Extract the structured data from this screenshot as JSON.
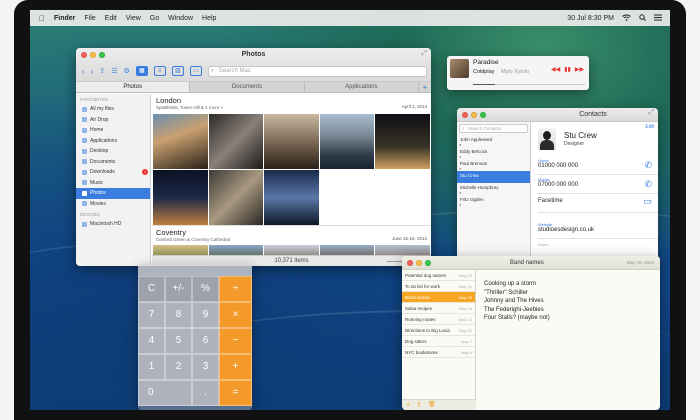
{
  "menubar": {
    "apple": "",
    "app_name": "Finder",
    "menus": [
      "File",
      "Edit",
      "View",
      "Go",
      "Window",
      "Help"
    ],
    "clock": "30 Jul  8:30 PM",
    "wifi_icon": "wifi-icon",
    "search_icon": "search-icon",
    "list_icon": "list-icon"
  },
  "finder": {
    "title": "Photos",
    "search_placeholder": "Search Mac",
    "tabs": [
      {
        "label": "Photos",
        "active": true
      },
      {
        "label": "Documents",
        "active": false
      },
      {
        "label": "Applications",
        "active": false
      }
    ],
    "tab_add": "+",
    "sidebar": {
      "favourites_header": "FAVOURITES",
      "items": [
        {
          "label": "All my files"
        },
        {
          "label": "Air Drop"
        },
        {
          "label": "Home"
        },
        {
          "label": "Applications"
        },
        {
          "label": "Desktop"
        },
        {
          "label": "Documents"
        },
        {
          "label": "Downloads",
          "badge": "!"
        },
        {
          "label": "Music"
        },
        {
          "label": "Photos",
          "selected": true
        },
        {
          "label": "Movies"
        }
      ],
      "devices_header": "DEVICES",
      "devices": [
        {
          "label": "Macintosh HD"
        }
      ]
    },
    "events": [
      {
        "title": "London",
        "subtitle": "Spitalfields, Tower Hill & 1 more >",
        "date": "April 2, 2013"
      },
      {
        "title": "Coventry",
        "subtitle": "Gosford Green & Coventry Cathedral",
        "date": "June 15-16, 2013"
      }
    ],
    "status": "10,371 items",
    "zoom_level": 0.65
  },
  "notification": {
    "track": "Paradise",
    "artist": "Coldplay",
    "album": "Mylo Xyloto",
    "controls": [
      "◀◀",
      "▮▮",
      "▶▶"
    ],
    "progress": 0.2
  },
  "contacts": {
    "title": "Contacts",
    "search_placeholder": "Search Contacts",
    "list": [
      {
        "name": "John Appleseed"
      },
      {
        "name": "Eddy Belcock"
      },
      {
        "name": "Paul Brennan"
      },
      {
        "name": "Stu Crew",
        "selected": true
      },
      {
        "name": "Michelle Humphrey"
      },
      {
        "name": "Fritz Ogden"
      }
    ],
    "edit_label": "Edit",
    "name": "Stu Crew",
    "role": "Designer",
    "fields": [
      {
        "label": "Home",
        "value": "01000 000 000"
      },
      {
        "label": "Mobile",
        "value": "07000 000 000"
      },
      {
        "label": "",
        "value": "Facetime"
      },
      {
        "label": "Website",
        "value": "studioesdesign.co.uk"
      }
    ],
    "note_label": "Notes",
    "bottom_buttons": [
      "+",
      "⇪",
      "🗑"
    ]
  },
  "calculator": {
    "keys": [
      "C",
      "+/-",
      "%",
      "÷",
      "7",
      "8",
      "9",
      "×",
      "4",
      "5",
      "6",
      "−",
      "1",
      "2",
      "3",
      "+",
      "0",
      ".",
      "="
    ]
  },
  "notes": {
    "title": "Band names",
    "date": "May 29, 2013",
    "list": [
      {
        "title": "Potential dog names",
        "date": "May 23"
      },
      {
        "title": "To do list for work",
        "date": "May 21"
      },
      {
        "title": "Band names",
        "date": "May 29",
        "selected": true
      },
      {
        "title": "Salsa recipes",
        "date": "May 14"
      },
      {
        "title": "Running routes",
        "date": "May 12"
      },
      {
        "title": "Directions to Big Lucia",
        "date": "May 10"
      },
      {
        "title": "Dog sitters",
        "date": "May 7"
      },
      {
        "title": "NYC bookstores",
        "date": "May 6"
      }
    ],
    "body": [
      "Cooking up a storm",
      "\"Thriller\" Schiller",
      "Johnny and The Hives",
      "The Federighi-Jeebies",
      "Four Stalls? (maybe not)"
    ],
    "bottom_buttons": [
      "+",
      "⇪",
      "🗑"
    ]
  },
  "colors": {
    "accent": "#3a7ddf",
    "calc_op": "#f39a2a",
    "notes_selected": "#f6a623"
  }
}
